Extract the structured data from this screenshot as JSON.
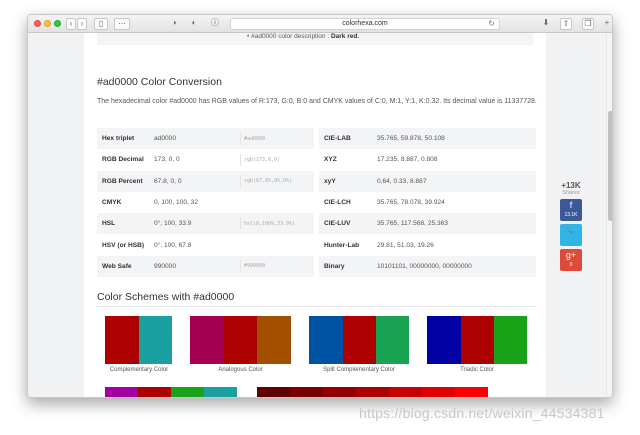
{
  "browser": {
    "url": "colorhexa.com",
    "reload_icon": "reload-icon"
  },
  "top_strip": {
    "text": "#ad0000 color description :",
    "value": "Dark red."
  },
  "conversion": {
    "title": "#ad0000 Color Conversion",
    "description": "The hexadecimal color #ad0000 has RGB values of R:173, G:0, B:0 and CMYK values of C:0, M:1, Y:1, K:0.32. Its decimal value is 11337728.",
    "left_rows": [
      {
        "label": "Hex triplet",
        "value": "ad0000",
        "code": "#ad0000"
      },
      {
        "label": "RGB Decimal",
        "value": "173, 0, 0",
        "code": "rgb(173,0,0)"
      },
      {
        "label": "RGB Percent",
        "value": "67.8, 0, 0",
        "code": "rgb(67.8%,0%,0%)"
      },
      {
        "label": "CMYK",
        "value": "0, 100, 100, 32",
        "code": ""
      },
      {
        "label": "HSL",
        "value": "0°, 100, 33.9",
        "code": "hsl(0,100%,33.9%)"
      },
      {
        "label": "HSV (or HSB)",
        "value": "0°, 100, 67.8",
        "code": ""
      },
      {
        "label": "Web Safe",
        "value": "990000",
        "code": "#990000"
      }
    ],
    "right_rows": [
      {
        "label": "CIE-LAB",
        "value": "35.765, 59.878, 50.108"
      },
      {
        "label": "XYZ",
        "value": "17.235, 8.887, 0.808"
      },
      {
        "label": "xyY",
        "value": "0.64, 0.33, 8.887"
      },
      {
        "label": "CIE-LCH",
        "value": "35.765, 78.078, 39.924"
      },
      {
        "label": "CIE-LUV",
        "value": "35.765, 117.568, 25.363"
      },
      {
        "label": "Hunter-Lab",
        "value": "29.81, 51.03, 19.26"
      },
      {
        "label": "Binary",
        "value": "10101101, 00000000, 00000000"
      }
    ]
  },
  "schemes": {
    "title": "Color Schemes with #ad0000",
    "items": [
      {
        "label": "Complementary Color",
        "colors": [
          "#ad0000",
          "#1aa0a0"
        ]
      },
      {
        "label": "Analogous Color",
        "colors": [
          "#a30052",
          "#ad0000",
          "#a34f00"
        ]
      },
      {
        "label": "Split Complementary Color",
        "colors": [
          "#0052a3",
          "#ad0000",
          "#19a352"
        ]
      },
      {
        "label": "Triadic Color",
        "colors": [
          "#0000a3",
          "#ad0000",
          "#19a319"
        ]
      }
    ],
    "row2_left": [
      "#a300a3",
      "#ad0000",
      "#19a319",
      "#1aa0a0"
    ],
    "row2_right": [
      "#610000",
      "#7a0000",
      "#940000",
      "#ad0000",
      "#c70000",
      "#e00000",
      "#fa0000"
    ]
  },
  "share": {
    "count": "+13K",
    "label": "Shares",
    "facebook_count": "13.1K",
    "twitter_count": "",
    "gplus_count": "0"
  },
  "watermark": "https://blog.csdn.net/weixin_44534381"
}
